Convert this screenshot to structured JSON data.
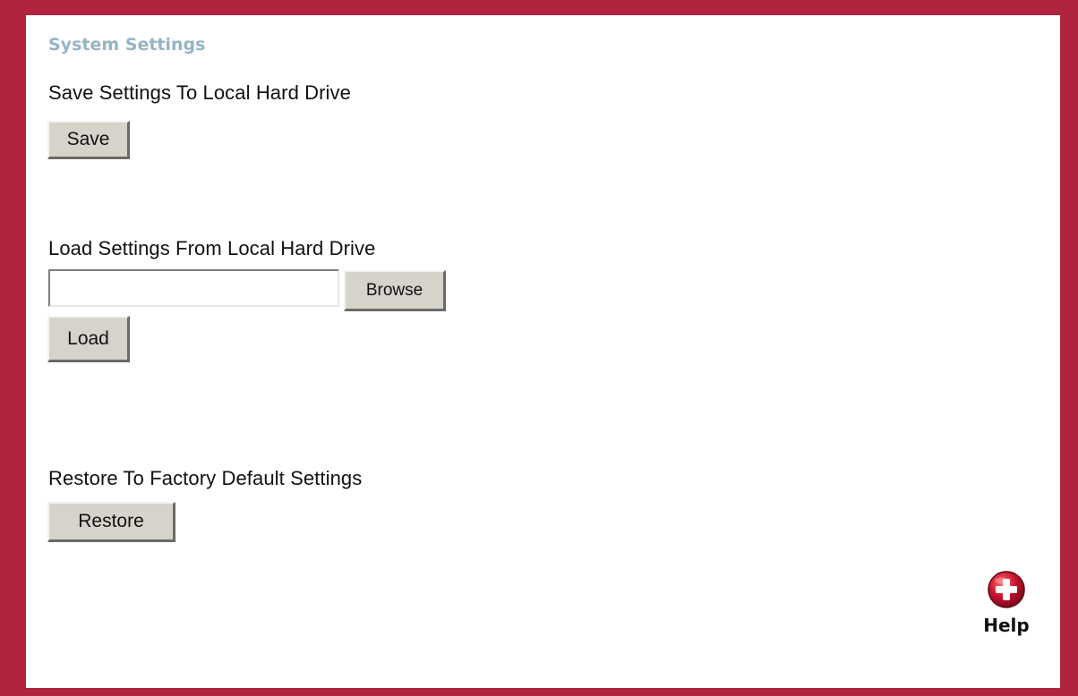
{
  "page": {
    "title": "System Settings"
  },
  "save_section": {
    "label": "Save Settings To Local Hard Drive",
    "button": "Save"
  },
  "load_section": {
    "label": "Load Settings From Local Hard Drive",
    "file_value": "",
    "browse_button": "Browse",
    "load_button": "Load"
  },
  "restore_section": {
    "label": "Restore To Factory Default Settings",
    "button": "Restore"
  },
  "help": {
    "label": "Help",
    "icon": "help-plus-icon"
  },
  "colors": {
    "frame": "#b0243f",
    "title": "#95b4c6",
    "button": "#d6d3cb",
    "help_icon": "#c8102e"
  }
}
